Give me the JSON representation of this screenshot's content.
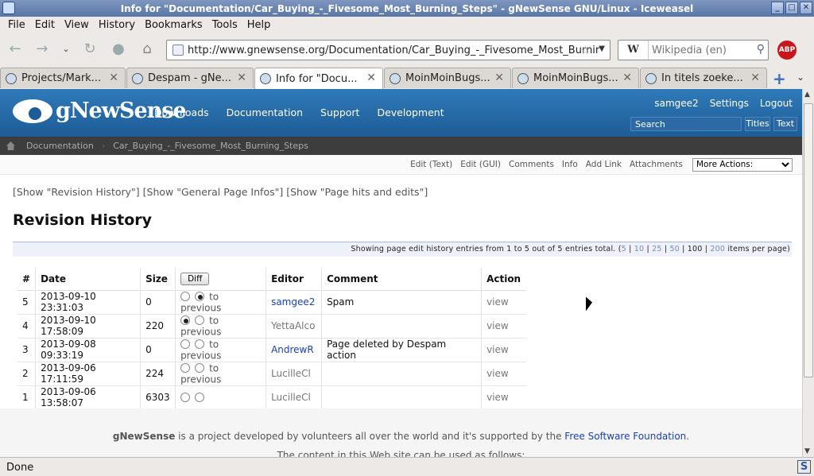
{
  "window": {
    "title": "Info for \"Documentation/Car_Buying_-_Fivesome_Most_Burning_Steps\" - gNewSense GNU/Linux - Iceweasel"
  },
  "menu": {
    "items": [
      "File",
      "Edit",
      "View",
      "History",
      "Bookmarks",
      "Tools",
      "Help"
    ]
  },
  "nav": {
    "url": "http://www.gnewsense.org/Documentation/Car_Buying_-_Fivesome_Most_Burnir",
    "search_engine": "W",
    "search_placeholder": "Wikipedia (en)",
    "adblock": "ABP"
  },
  "tabs": [
    {
      "label": "Projects/Mark...",
      "active": false
    },
    {
      "label": "Despam - gNe...",
      "active": false
    },
    {
      "label": "Info for \"Docu...",
      "active": true
    },
    {
      "label": "MoinMoinBugs...",
      "active": false
    },
    {
      "label": "MoinMoinBugs...",
      "active": false
    },
    {
      "label": "In titels zoeke...",
      "active": false
    }
  ],
  "site": {
    "logo_text": "gNewSense",
    "nav": [
      "Downloads",
      "Documentation",
      "Support",
      "Development"
    ],
    "user_links": [
      "samgee2",
      "Settings",
      "Logout"
    ],
    "search_value": "Search",
    "titles_btn": "Titles",
    "text_btn": "Text"
  },
  "breadcrumb": [
    "Documentation",
    "Car_Buying_-_Fivesome_Most_Burning_Steps"
  ],
  "page_actions": [
    "Edit (Text)",
    "Edit (GUI)",
    "Comments",
    "Info",
    "Add Link",
    "Attachments"
  ],
  "more_actions": "More Actions:",
  "show_links": {
    "revision_history": "Show \"Revision History\"",
    "general_page_infos": "Show \"General Page Infos\"",
    "page_hits": "Show \"Page hits and edits\""
  },
  "heading": "Revision History",
  "info_text": "Showing page edit history entries from 1 to 5 out of 5 entries total.",
  "page_sizes": [
    "5",
    "10",
    "25",
    "50",
    "100",
    "200"
  ],
  "current_page_size": "100",
  "items_per_page": "items per page)",
  "table": {
    "headers": [
      "#",
      "Date",
      "Size",
      "Diff",
      "Editor",
      "Comment",
      "Action"
    ],
    "rows": [
      {
        "num": "5",
        "date": "2013-09-10 23:31:03",
        "size": "0",
        "r1": false,
        "r2": true,
        "diff_label": "to previous",
        "editor": "samgee2",
        "editor_link": true,
        "comment": "Spam",
        "action": "view"
      },
      {
        "num": "4",
        "date": "2013-09-10 17:58:09",
        "size": "220",
        "r1": true,
        "r2": false,
        "diff_label": "to previous",
        "editor": "YettaAlco",
        "editor_link": false,
        "comment": "",
        "action": "view"
      },
      {
        "num": "3",
        "date": "2013-09-08 09:33:19",
        "size": "0",
        "r1": false,
        "r2": false,
        "diff_label": "to previous",
        "editor": "AndrewR",
        "editor_link": true,
        "comment": "Page deleted by Despam action",
        "action": "view"
      },
      {
        "num": "2",
        "date": "2013-09-06 17:11:59",
        "size": "224",
        "r1": false,
        "r2": false,
        "diff_label": "to previous",
        "editor": "LucilleCl",
        "editor_link": false,
        "comment": "",
        "action": "view"
      },
      {
        "num": "1",
        "date": "2013-09-06 13:58:07",
        "size": "6303",
        "r1": false,
        "r2": false,
        "diff_label": "",
        "editor": "LucilleCl",
        "editor_link": false,
        "comment": "",
        "action": "view"
      }
    ]
  },
  "footer": {
    "brand": "gNewSense",
    "text": " is a project developed by volunteers all over the world and it's supported by the ",
    "fsf": "Free Software Foundation",
    "dot": ".",
    "line2": "The content in this Web site can be used as follows:"
  },
  "status": {
    "text": "Done"
  }
}
